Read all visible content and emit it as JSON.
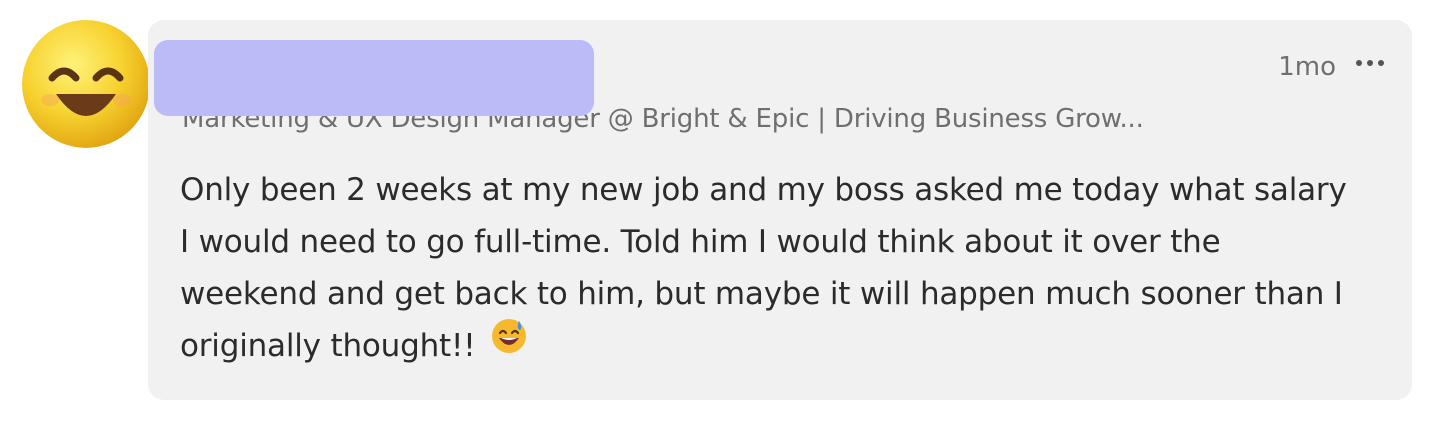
{
  "comment": {
    "author_headline": "Marketing & UX Design Manager @ Bright & Epic | Driving Business Grow...",
    "timestamp": "1mo",
    "text": "Only been 2 weeks at my new job and my boss asked me today what salary I would need to go full-time. Told him I would think about it over the weekend and get back to him, but maybe it will happen much sooner than I originally thought!!",
    "avatar_icon": "smiling-face-emoji-icon",
    "inline_emoji_icon": "grinning-sweat-emoji-icon",
    "more_icon": "more-options-icon"
  },
  "colors": {
    "bubble_background": "#f1f1f1",
    "redaction": "#babbf7",
    "meta_text": "#6f6f6f",
    "body_text": "#2b2b2b"
  }
}
